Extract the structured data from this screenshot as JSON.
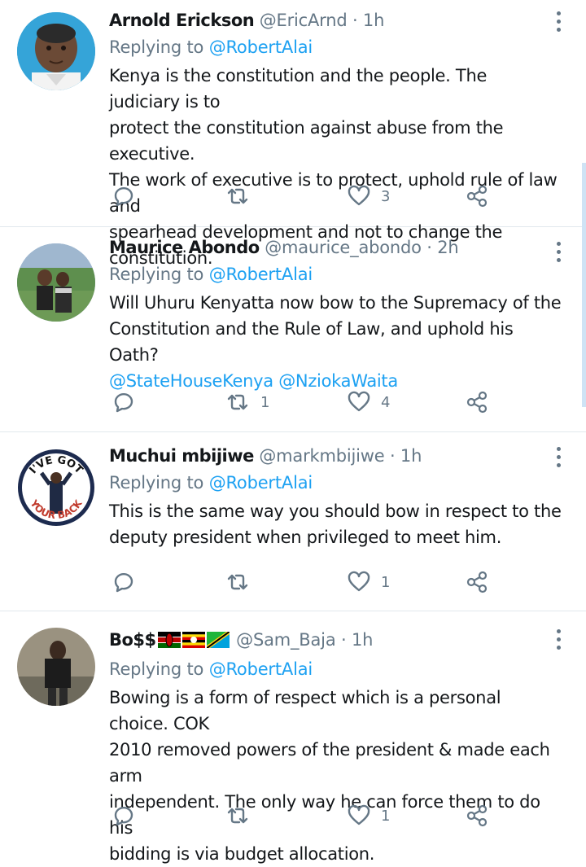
{
  "tweets": [
    {
      "name": "Arnold Erickson",
      "handle": "@EricArnd",
      "separator": "·",
      "time": "1h",
      "replying_prefix": "Replying to",
      "replying_to": "@RobertAlai",
      "text_lines": [
        "Kenya is the constitution and the people. The judiciary is to",
        "protect the constitution against abuse from the executive.",
        "The work of executive is to protect, uphold rule of law and",
        "spearhead development and not to change the constitution."
      ],
      "retweets": "",
      "likes": "3"
    },
    {
      "name": "Maurice Abondo",
      "handle": "@maurice_abondo",
      "separator": "·",
      "time": "2h",
      "replying_prefix": "Replying to",
      "replying_to": "@RobertAlai",
      "text_lines": [
        "Will Uhuru Kenyatta now bow to the Supremacy of the",
        "Constitution and the Rule of Law, and uphold his Oath?"
      ],
      "mentions_line": "@StateHouseKenya @NziokaWaita",
      "retweets": "1",
      "likes": "4"
    },
    {
      "name": "Muchui mbijiwe",
      "handle": "@markmbijiwe",
      "separator": "·",
      "time": "1h",
      "replying_prefix": "Replying to",
      "replying_to": "@RobertAlai",
      "text_lines": [
        "This is the same way you should bow in respect to the",
        "deputy president when privileged to meet him."
      ],
      "avatar_text_top": "I'VE GOT",
      "avatar_text_bottom": "YOUR BACK",
      "retweets": "",
      "likes": "1"
    },
    {
      "name": "Bo$$",
      "handle": "@Sam_Baja",
      "separator": "·",
      "time": "1h",
      "replying_prefix": "Replying to",
      "replying_to": "@RobertAlai",
      "text_lines": [
        "Bowing is a form of respect which is a personal choice. COK",
        "2010 removed powers of the president & made each arm",
        "independent. The only way he can force them to do his",
        "bidding is via budget allocation."
      ],
      "flags": [
        "kenya-flag",
        "uganda-flag",
        "tanzania-flag"
      ],
      "retweets": "",
      "likes": "1"
    }
  ],
  "colors": {
    "text": "#14171a",
    "muted": "#657786",
    "link": "#1da1f2",
    "divider": "#e1e8ed"
  }
}
